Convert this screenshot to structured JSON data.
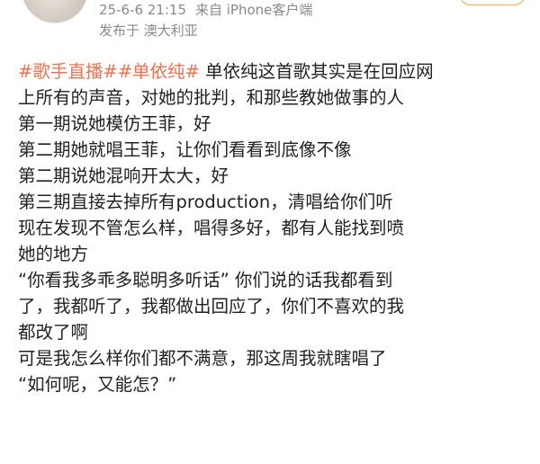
{
  "post": {
    "timestamp": "25-6-6 21:15",
    "source": "来自 iPhone客户端",
    "location": "发布于 澳大利亚",
    "hashtags": [
      "#歌手直播#",
      "#单依纯#"
    ],
    "lines": [
      "单依纯这首歌其实是在回应网",
      "上所有的声音，对她的批判，和那些教她做事的人",
      "第一期说她模仿王菲，好",
      "第二期她就唱王菲，让你们看看到底像不像",
      "第二期说她混响开太大，好",
      "第三期直接去掉所有production，清唱给你们听",
      "现在发现不管怎么样，唱得多好，都有人能找到喷",
      "她的地方",
      "“你看我多乖多聪明多听话” 你们说的话我都看到",
      "了，我都听了，我都做出回应了，你们不喜欢的我",
      "都改了啊",
      "可是我怎么样你们都不满意，那这周我就瞎唱了",
      "“如何呢，又能怎？”"
    ]
  },
  "colors": {
    "hashtag": "#eb7350",
    "meta": "#8a8a8a",
    "text": "#222222"
  }
}
